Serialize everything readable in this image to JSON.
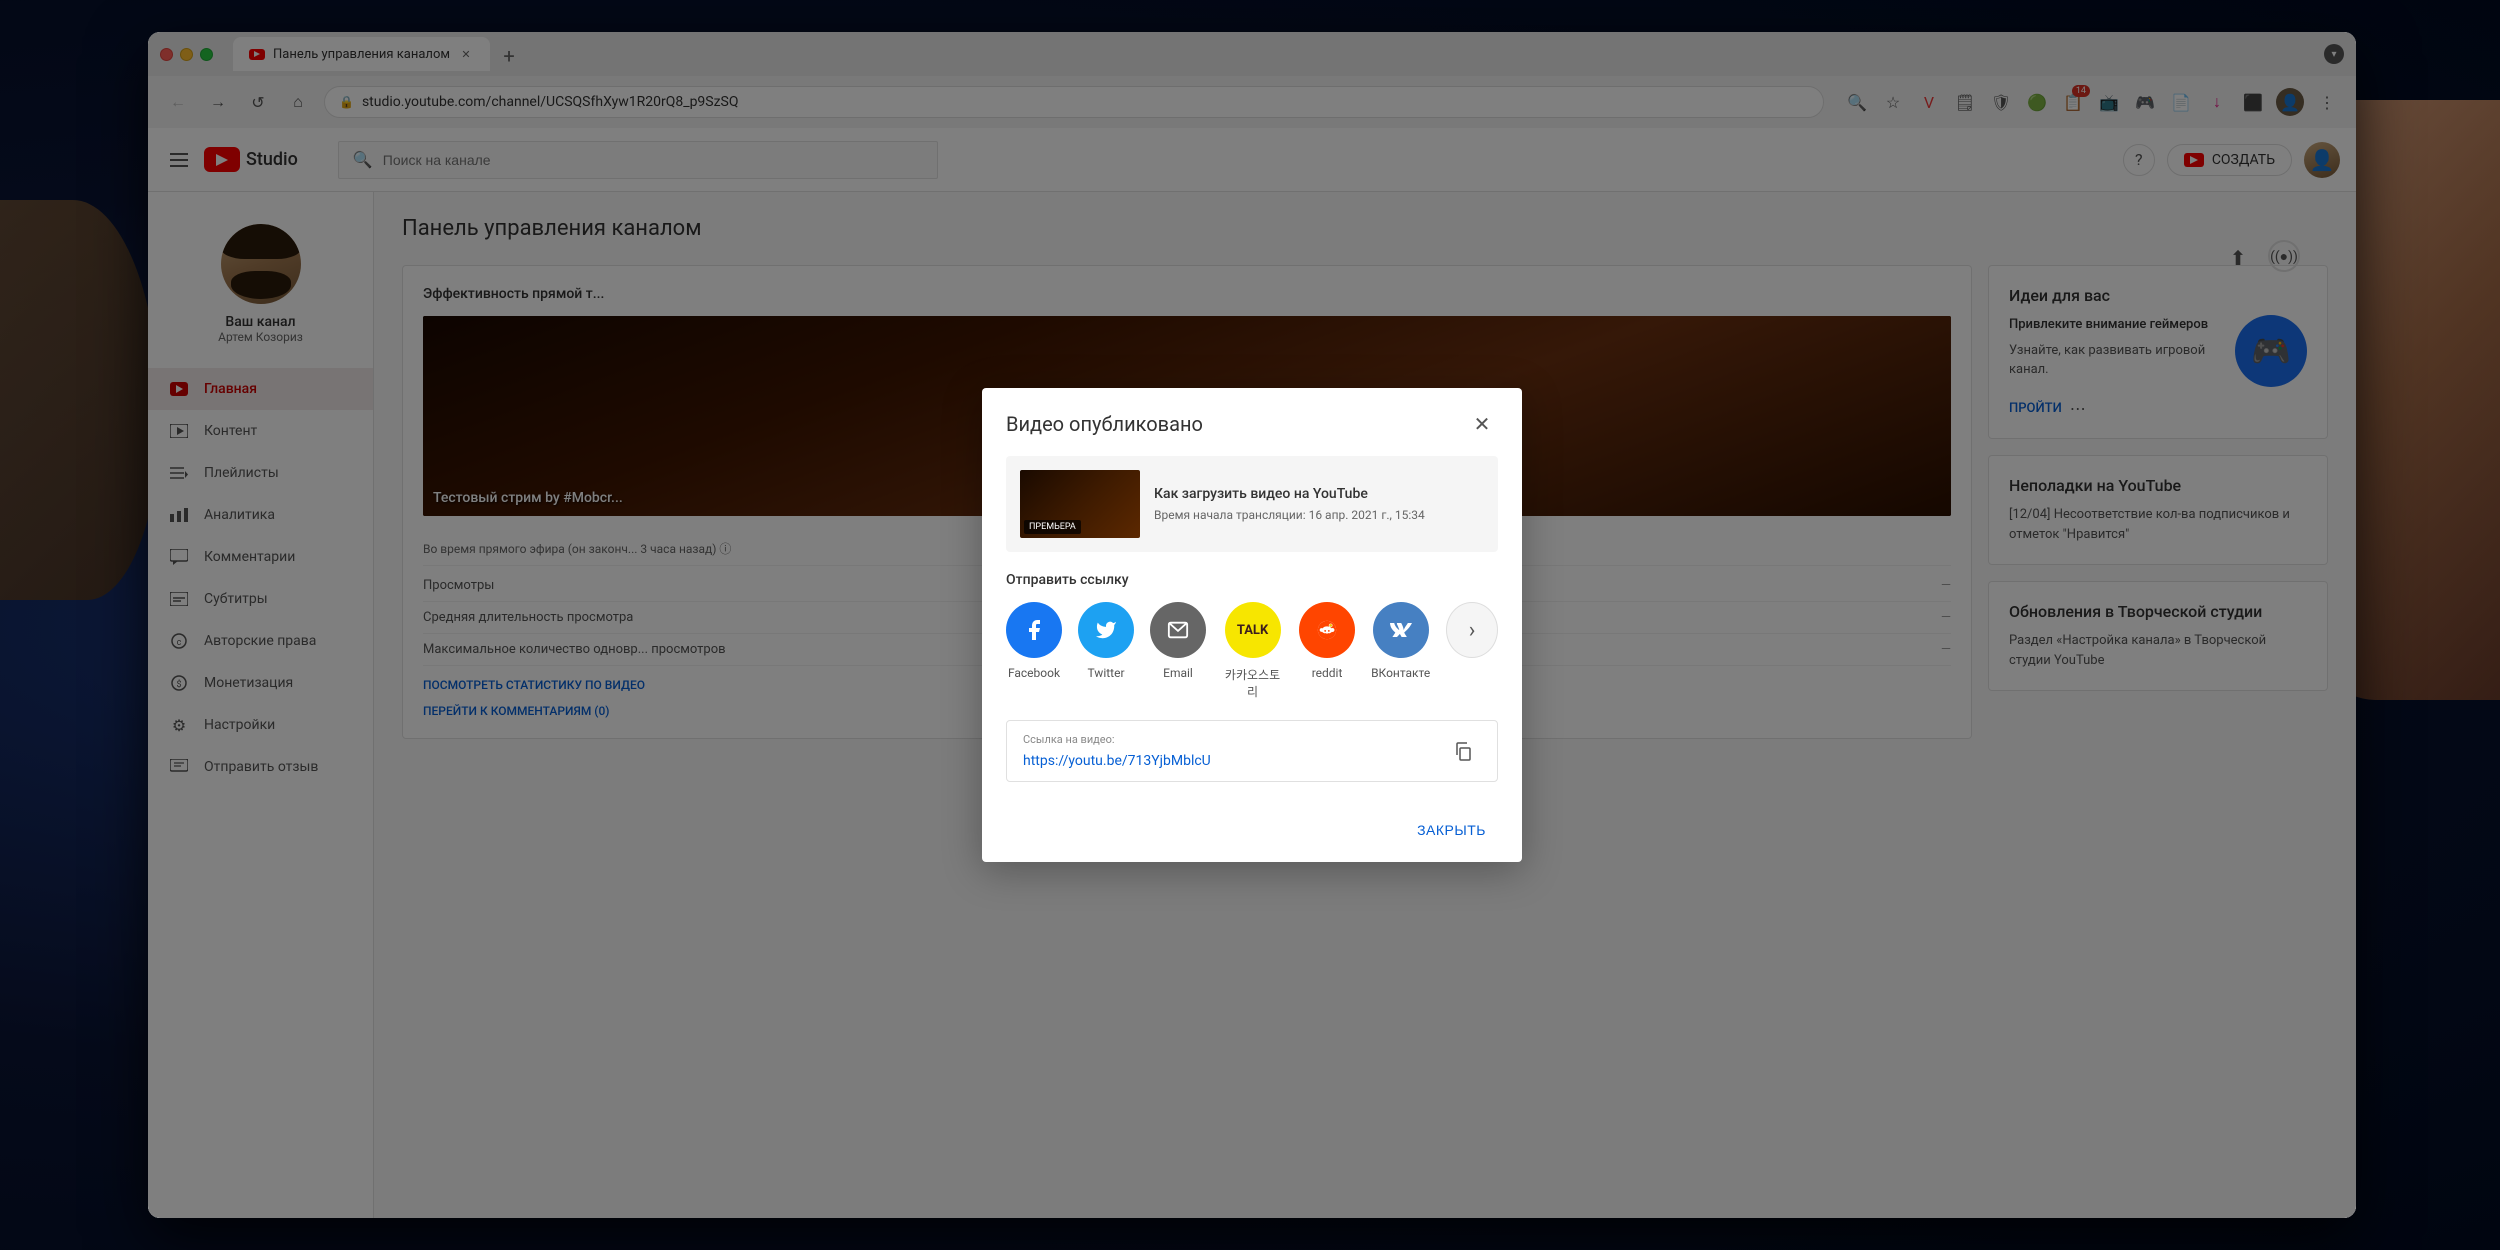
{
  "browser": {
    "tab_title": "Панель управления каналом",
    "url": "studio.youtube.com/channel/UCSQSfhXyw1R20rQ8_p9SzSQ",
    "new_tab_label": "+",
    "dropdown_label": "▼"
  },
  "header": {
    "search_placeholder": "Поиск на канале",
    "create_button": "СОЗДАТЬ",
    "logo_text": "Studio"
  },
  "sidebar": {
    "channel_name": "Ваш канал",
    "username": "Артем Козориз",
    "items": [
      {
        "label": "Главная",
        "icon": "home",
        "active": true
      },
      {
        "label": "Контент",
        "icon": "video"
      },
      {
        "label": "Плейлисты",
        "icon": "list"
      },
      {
        "label": "Аналитика",
        "icon": "chart"
      },
      {
        "label": "Комментарии",
        "icon": "comment"
      },
      {
        "label": "Субтитры",
        "icon": "subtitle"
      },
      {
        "label": "Авторские права",
        "icon": "copyright"
      },
      {
        "label": "Монетизация",
        "icon": "money"
      },
      {
        "label": "Настройки",
        "icon": "settings"
      },
      {
        "label": "Отправить отзыв",
        "icon": "feedback"
      }
    ]
  },
  "page": {
    "title": "Панель управления каналом",
    "stream_card_title": "Эффективность прямой т...",
    "stream_title": "Тестовый стрим by #Mobcr...",
    "stream_meta": "Во время прямого эфира (он законч... 3 часа назад) ⓘ",
    "stats": [
      {
        "label": "Просмотры"
      },
      {
        "label": "Средняя длительность просмотра"
      },
      {
        "label": "Максимальное количество одновр... просмотров"
      }
    ],
    "stat_link1": "ПОСМОТРЕТЬ СТАТИСТИКУ ПО ВИДЕО",
    "stat_link2": "ПЕРЕЙТИ К КОММЕНТАРИЯМ (0)"
  },
  "right_panel": {
    "ideas_title": "Идеи для вас",
    "ideas_subtitle": "Привлеките внимание геймеров",
    "ideas_desc": "Узнайте, как развивать игровой канал.",
    "ideas_action": "ПРОЙТИ",
    "issues_title": "Неполадки на YouTube",
    "issues_desc": "[12/04] Несоответствие кол-ва подписчиков и отметок \"Нравится\"",
    "updates_title": "Обновления в Творческой студии",
    "updates_desc": "Раздел «Настройка канала» в Творческой студии YouTube"
  },
  "modal": {
    "title": "Видео опубликовано",
    "close_btn_label": "✕",
    "video_title": "Как загрузить видео на YouTube",
    "video_meta": "Время начала трансляции: 16 апр. 2021 г., 15:34",
    "share_label": "Отправить ссылку",
    "share_items": [
      {
        "label": "Facebook",
        "icon": "fb"
      },
      {
        "label": "Twitter",
        "icon": "tw"
      },
      {
        "label": "Email",
        "icon": "email"
      },
      {
        "label": "카카오스토리",
        "icon": "kakao"
      },
      {
        "label": "reddit",
        "icon": "reddit"
      },
      {
        "label": "ВКонтакте",
        "icon": "vk"
      }
    ],
    "next_button_label": "›",
    "link_label": "Ссылка на видео:",
    "link_url": "https://youtu.be/713YjbMblcU",
    "copy_icon": "⧉",
    "close_action_label": "ЗАКРЫТЬ"
  }
}
